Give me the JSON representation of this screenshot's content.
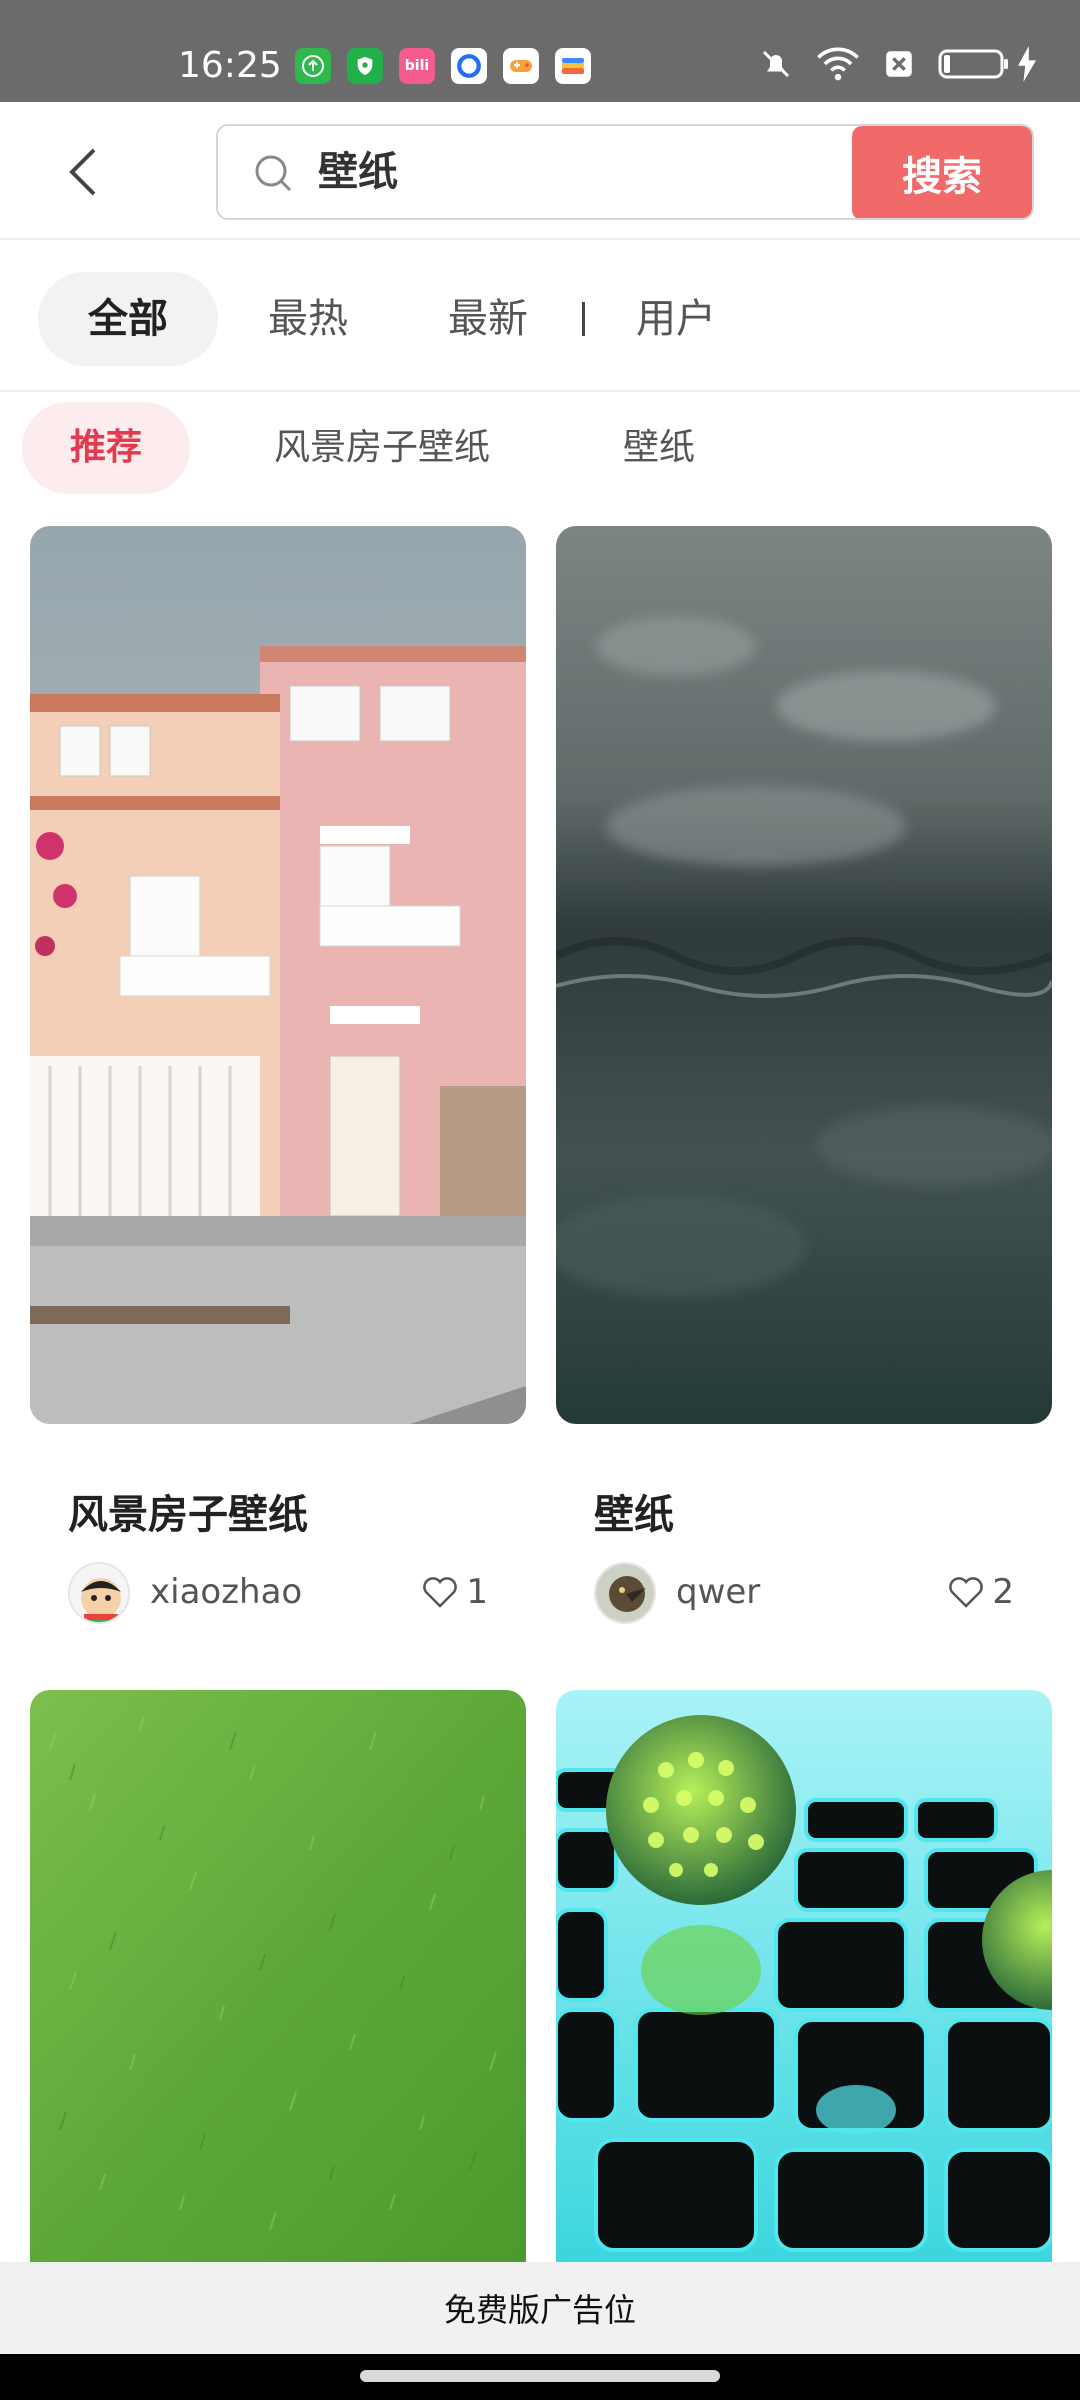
{
  "status_bar": {
    "time": "16:25",
    "app_icons": [
      "upload-app-icon",
      "shield-app-icon",
      "bilibili-app-icon",
      "browser-app-icon",
      "game-app-icon",
      "wallet-app-icon"
    ],
    "right_icons": [
      "bell-muted-icon",
      "wifi-icon",
      "sim-off-icon",
      "battery-icon",
      "charging-icon"
    ],
    "colors": {
      "background": "#6b6b6b"
    }
  },
  "search": {
    "query": "壁纸",
    "button_label": "搜索",
    "accent": "#f06a6a"
  },
  "tabs": [
    {
      "label": "全部",
      "active": true
    },
    {
      "label": "最热",
      "active": false
    },
    {
      "label": "最新",
      "active": false
    },
    {
      "label": "用户",
      "active": false
    }
  ],
  "subtabs": [
    {
      "label": "推荐",
      "active": true
    },
    {
      "label": "风景房子壁纸",
      "active": false
    },
    {
      "label": "壁纸",
      "active": false
    }
  ],
  "cards": [
    {
      "title": "风景房子壁纸",
      "author": "xiaozhao",
      "likes": "1",
      "image": "pink-house-photo",
      "avatar": "cartoon-boy-avatar"
    },
    {
      "title": "壁纸",
      "author": "qwer",
      "likes": "2",
      "image": "textured-surface-photo",
      "avatar": "bird-avatar"
    },
    {
      "image": "grass-photo"
    },
    {
      "image": "glowing-spheres-render"
    }
  ],
  "ad": {
    "label": "免费版广告位"
  }
}
